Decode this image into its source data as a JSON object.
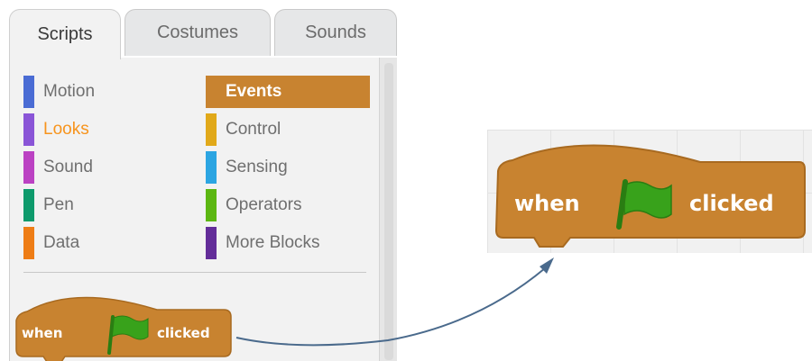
{
  "tabs": [
    {
      "label": "Scripts",
      "active": true
    },
    {
      "label": "Costumes",
      "active": false
    },
    {
      "label": "Sounds",
      "active": false
    }
  ],
  "categories": {
    "motion": {
      "label": "Motion",
      "color": "#4a6cd4"
    },
    "looks": {
      "label": "Looks",
      "color": "#8a55d7",
      "label_color": "#f7941d"
    },
    "sound": {
      "label": "Sound",
      "color": "#bb42c3"
    },
    "pen": {
      "label": "Pen",
      "color": "#0e9a6c"
    },
    "data": {
      "label": "Data",
      "color": "#ee7d16"
    },
    "events": {
      "label": "Events",
      "color": "#c88330",
      "selected": true
    },
    "control": {
      "label": "Control",
      "color": "#e1a91a"
    },
    "sensing": {
      "label": "Sensing",
      "color": "#2ca5e2"
    },
    "operators": {
      "label": "Operators",
      "color": "#5cb712"
    },
    "more": {
      "label": "More Blocks",
      "color": "#632d99"
    }
  },
  "block": {
    "when_label": "when",
    "clicked_label": "clicked",
    "color": "#c88330",
    "flag_color": "#38a21b",
    "flag_icon": "green-flag-icon"
  },
  "zoomed_block": {
    "when_label": "when",
    "clicked_label": "clicked"
  },
  "arrow_color": "#4a6a8c"
}
